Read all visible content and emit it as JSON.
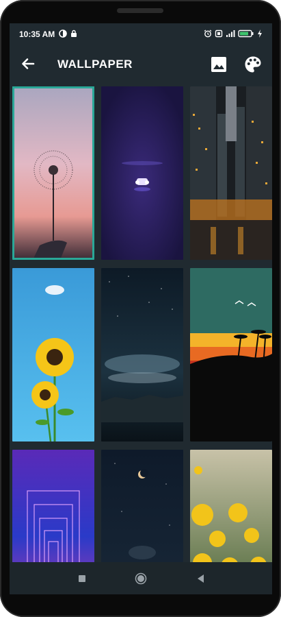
{
  "status": {
    "time": "10:35 AM",
    "battery": "battery-icon",
    "icons_left": [
      "data-saver-icon",
      "lock-icon"
    ],
    "icons_right": [
      "alarm-icon",
      "vibrate-icon",
      "signal-icon",
      "battery-icon",
      "charging-icon"
    ]
  },
  "appbar": {
    "title": "WALLPAPER",
    "back_icon": "arrow-left-icon",
    "actions": [
      "image-icon",
      "palette-icon"
    ]
  },
  "wallpapers": [
    {
      "subject": "dandelion",
      "selected": true
    },
    {
      "subject": "night-car"
    },
    {
      "subject": "city-street"
    },
    {
      "subject": "sunflowers"
    },
    {
      "subject": "night-sky-clouds"
    },
    {
      "subject": "sunset-palms"
    },
    {
      "subject": "neon-tunnel"
    },
    {
      "subject": "moon-night"
    },
    {
      "subject": "yellow-flowers"
    }
  ],
  "navigation": [
    "recent-apps-icon",
    "home-icon",
    "back-icon"
  ],
  "colors": {
    "background": "#202a30",
    "accent": "#2aa898",
    "navbar": "#1d262b"
  }
}
